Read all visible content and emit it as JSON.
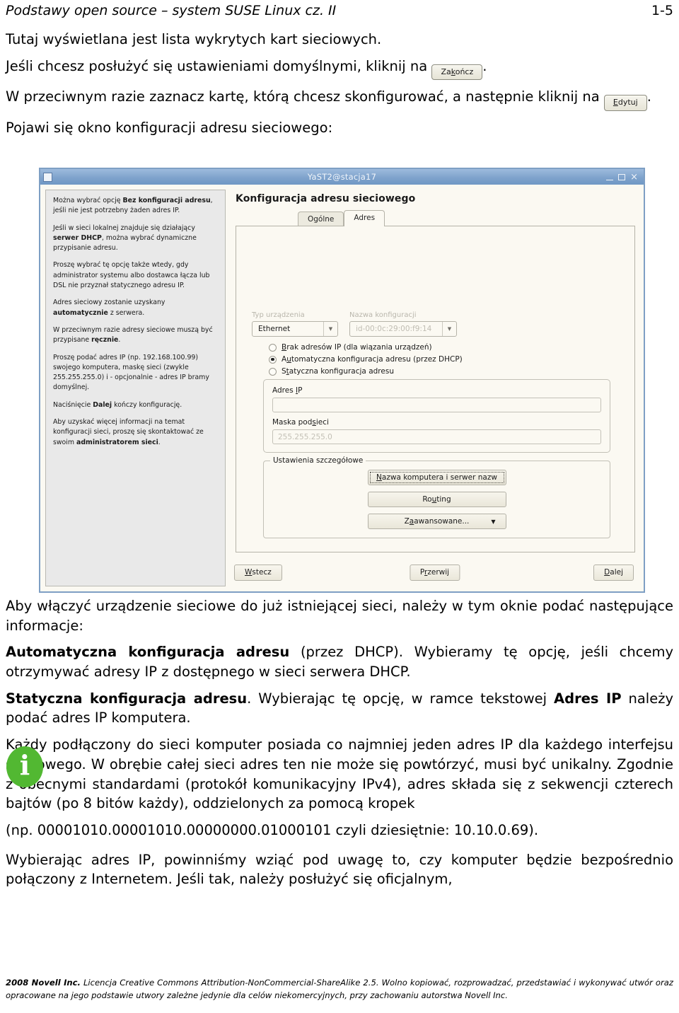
{
  "header": {
    "title": "Podstawy open source – system SUSE Linux  cz. II",
    "page_number": "1-5"
  },
  "body": {
    "p1": "Tutaj wyświetlana jest lista wykrytych kart sieciowych.",
    "p2_before": "Jeśli chcesz posłużyć się ustawieniami domyślnymi, kliknij na",
    "p2_after": ".",
    "p3_before": "W przeciwnym razie zaznacz kartę, którą chcesz skonfigurować, a następnie kliknij na",
    "p3_after": ".",
    "p4": "Pojawi się okno konfiguracji adresu sieciowego:",
    "p5": "Aby włączyć urządzenie sieciowe do już istniejącej sieci, należy w tym oknie podać następujące informacje:",
    "p6_bold": "Automatyczna konfiguracja adresu",
    "p6_rest": " (przez DHCP). Wybieramy tę opcję, jeśli chcemy otrzymywać adresy IP z dostępnego w sieci serwera DHCP.",
    "p7_bold": "Statyczna konfiguracja adresu",
    "p7_mid": ". Wybierając tę opcję, w ramce tekstowej ",
    "p7_bold2": "Adres IP",
    "p7_rest": " należy podać adres IP komputera.",
    "p8": "Każdy podłączony do sieci komputer posiada co najmniej jeden adres IP dla każdego interfejsu sieciowego. W obrębie całej sieci adres ten nie może się powtórzyć, musi być unikalny. Zgodnie z obecnymi standardami (protokół komunikacyjny IPv4), adres składa się z sekwencji czterech bajtów (po 8 bitów każdy), oddzielonych za pomocą kropek",
    "p9": "(np.    00001010.00001010.00000000.01000101    czyli    dziesiętnie: 10.10.0.69).",
    "p10": "Wybierając adres IP, powinniśmy wziąć pod uwagę to, czy komputer będzie bezpośrednio połączony z Internetem. Jeśli tak, należy posłużyć się oficjalnym,"
  },
  "inline_buttons": {
    "finish": "Zakończ",
    "finish_pre": "Za",
    "finish_acc": "k",
    "finish_post": "ończ",
    "edit_acc": "E",
    "edit_post": "dytuj"
  },
  "info_icon": {
    "glyph": "i",
    "color": "#52b832"
  },
  "yast": {
    "window_title": "YaST2@stacja17",
    "window_controls": {
      "minimize": "minimize-icon",
      "maximize": "maximize-icon",
      "close": "×"
    },
    "help": {
      "p1_a": "Można wybrać opcję ",
      "p1_b": "Bez konfiguracji adresu",
      "p1_c": ", jeśli nie jest potrzebny żaden adres IP.",
      "p2_a": "Jeśli w sieci lokalnej znajduje się działający ",
      "p2_b": "serwer DHCP",
      "p2_c": ", można wybrać dynamiczne przypisanie adresu.",
      "p3": "Proszę wybrać tę opcję także wtedy, gdy administrator systemu albo dostawca łącza lub DSL nie przyznał statycznego adresu IP.",
      "p4_a": "Adres sieciowy zostanie uzyskany ",
      "p4_b": "automatycznie",
      "p4_c": " z serwera.",
      "p5_a": "W przeciwnym razie adresy sieciowe muszą być przypisane ",
      "p5_b": "ręcznie",
      "p5_c": ".",
      "p6": "Proszę podać adres IP (np. 192.168.100.99) swojego komputera, maskę sieci (zwykle 255.255.255.0) i - opcjonalnie - adres IP bramy domyślnej.",
      "p7_a": "Naciśnięcie ",
      "p7_b": "Dalej",
      "p7_c": " kończy konfigurację.",
      "p8_a": "Aby uzyskać więcej informacji na temat konfiguracji sieci, proszę się skontaktować ze swoim ",
      "p8_b": "administratorem sieci",
      "p8_c": "."
    },
    "dialog_heading": "Konfiguracja adresu sieciowego",
    "tabs": [
      {
        "label": "Ogólne",
        "active": false
      },
      {
        "label": "Adres",
        "active": true
      }
    ],
    "device_type": {
      "label": "Typ urządzenia",
      "value": "Ethernet"
    },
    "config_name": {
      "label": "Nazwa konfiguracji",
      "value": "id-00:0c:29:00:f9:14"
    },
    "radios": [
      {
        "pre": "",
        "acc": "B",
        "post": "rak adresów IP (dla wiązania urządzeń)",
        "selected": false
      },
      {
        "pre": "A",
        "acc": "u",
        "post": "tomatyczna konfiguracja adresu (przez DHCP)",
        "selected": true
      },
      {
        "pre": "S",
        "acc": "t",
        "post": "atyczna konfiguracja adresu",
        "selected": false
      }
    ],
    "ip_address": {
      "label_pre": "Adres ",
      "label_acc": "I",
      "label_post": "P",
      "value": ""
    },
    "netmask": {
      "label_pre": "Maska pod",
      "label_acc": "s",
      "label_post": "ieci",
      "placeholder": "255.255.255.0"
    },
    "details_group": {
      "legend": "Ustawienia szczegółowe",
      "buttons": [
        {
          "pre": "",
          "acc": "N",
          "post": "azwa komputera i serwer nazw",
          "focused": true,
          "caret": false
        },
        {
          "pre": "Ro",
          "acc": "u",
          "post": "ting",
          "focused": false,
          "caret": false
        },
        {
          "pre": "Z",
          "acc": "a",
          "post": "awansowane...",
          "focused": false,
          "caret": true
        }
      ]
    },
    "action_buttons": {
      "back": {
        "pre": "",
        "acc": "W",
        "post": "stecz"
      },
      "abort": {
        "pre": "P",
        "acc": "r",
        "post": "zerwij"
      },
      "next": {
        "pre": "",
        "acc": "D",
        "post": "alej"
      }
    }
  },
  "footer": {
    "copyright": "2008 Novell Inc.",
    "license": " Licencja Creative Commons Attribution-NonCommercial-ShareAlike 2.5. Wolno kopiować, rozprowadzać, przedstawiać i wykonywać utwór oraz opracowane na jego podstawie utwory zależne jedynie dla celów niekomercyjnych, przy zachowaniu autorstwa Novell Inc."
  }
}
